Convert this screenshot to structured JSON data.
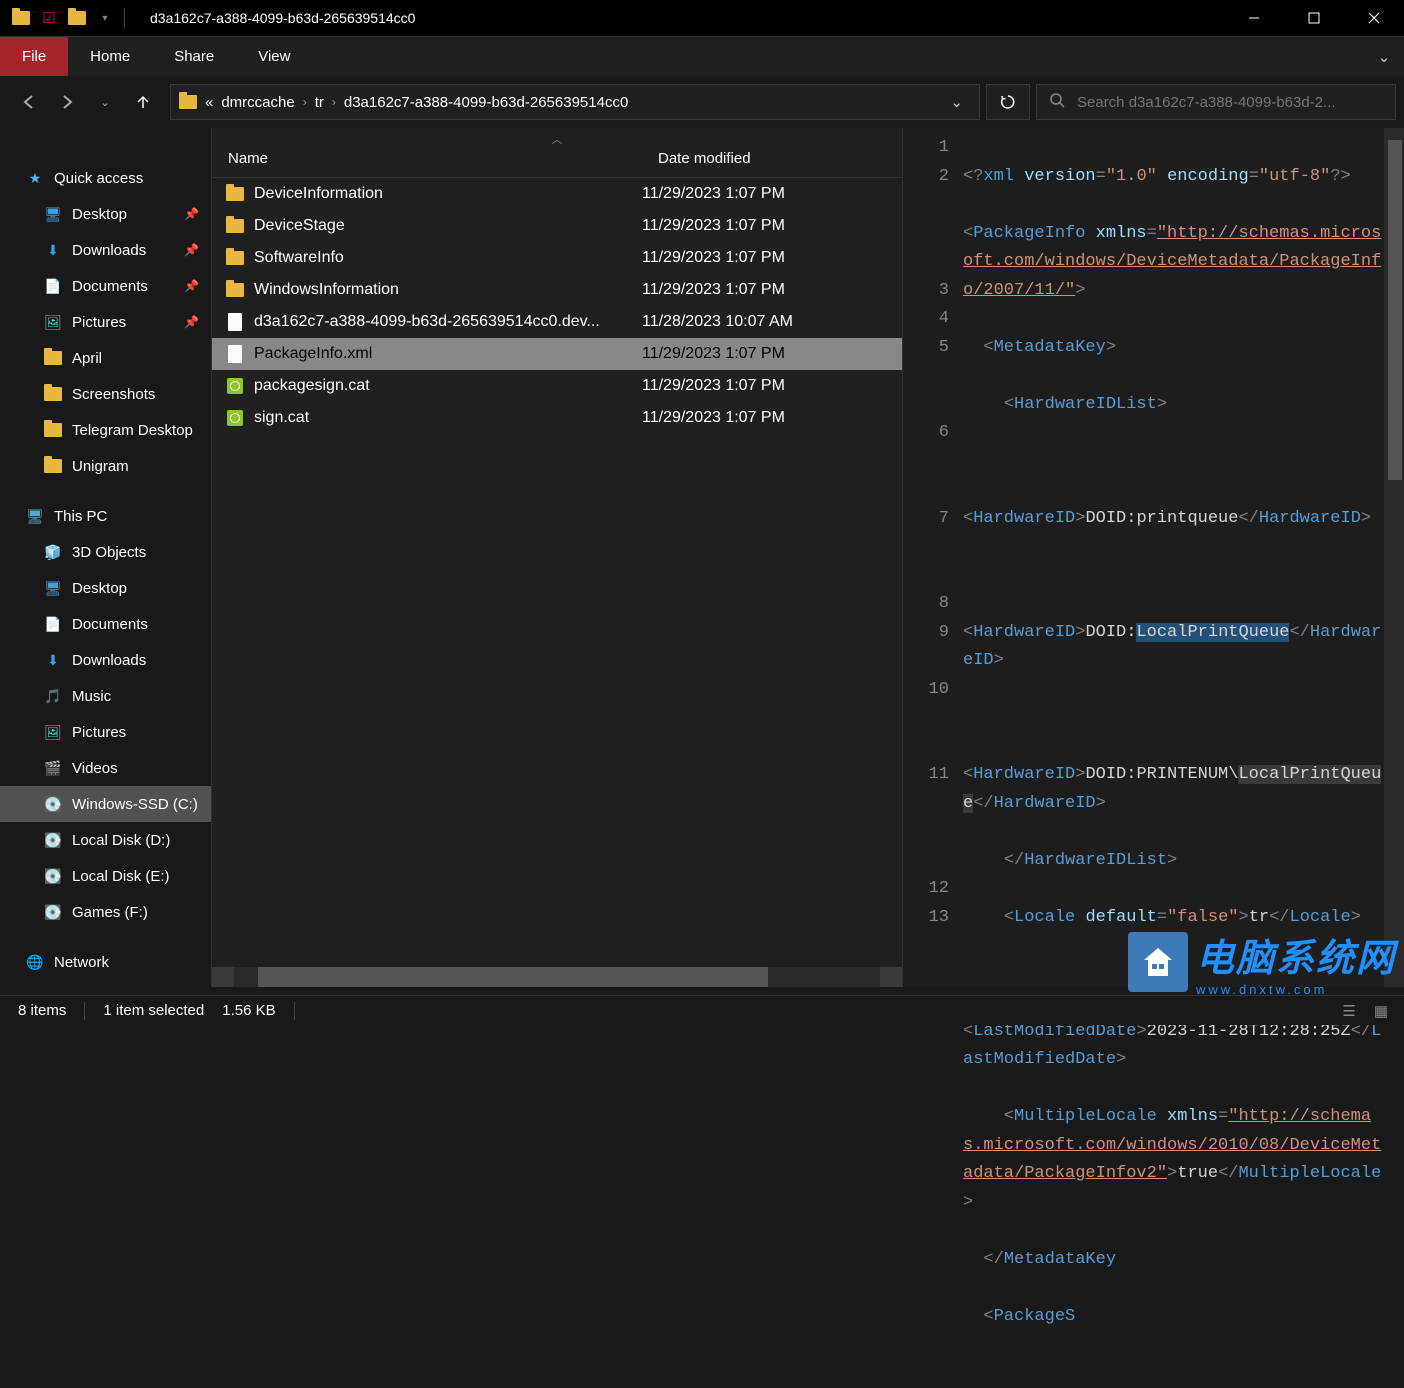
{
  "window": {
    "title": "d3a162c7-a388-4099-b63d-265639514cc0"
  },
  "ribbon": {
    "file": "File",
    "home": "Home",
    "share": "Share",
    "view": "View"
  },
  "breadcrumb": {
    "overflow": "«",
    "items": [
      "dmrccache",
      "tr",
      "d3a162c7-a388-4099-b63d-265639514cc0"
    ]
  },
  "search": {
    "placeholder": "Search d3a162c7-a388-4099-b63d-2..."
  },
  "nav": {
    "quick_access": "Quick access",
    "pinned": [
      {
        "label": "Desktop",
        "icon": "desktop"
      },
      {
        "label": "Downloads",
        "icon": "down"
      },
      {
        "label": "Documents",
        "icon": "doc"
      },
      {
        "label": "Pictures",
        "icon": "pic"
      }
    ],
    "recent": [
      {
        "label": "April"
      },
      {
        "label": "Screenshots"
      },
      {
        "label": "Telegram Desktop"
      },
      {
        "label": "Unigram"
      }
    ],
    "this_pc": "This PC",
    "pc_items": [
      {
        "label": "3D Objects"
      },
      {
        "label": "Desktop"
      },
      {
        "label": "Documents"
      },
      {
        "label": "Downloads"
      },
      {
        "label": "Music"
      },
      {
        "label": "Pictures"
      },
      {
        "label": "Videos"
      },
      {
        "label": "Windows-SSD (C:)",
        "selected": true
      },
      {
        "label": "Local Disk (D:)"
      },
      {
        "label": "Local Disk (E:)"
      },
      {
        "label": "Games (F:)"
      }
    ],
    "network": "Network"
  },
  "columns": {
    "name": "Name",
    "date": "Date modified"
  },
  "files": [
    {
      "name": "DeviceInformation",
      "type": "folder",
      "date": "11/29/2023 1:07 PM"
    },
    {
      "name": "DeviceStage",
      "type": "folder",
      "date": "11/29/2023 1:07 PM"
    },
    {
      "name": "SoftwareInfo",
      "type": "folder",
      "date": "11/29/2023 1:07 PM"
    },
    {
      "name": "WindowsInformation",
      "type": "folder",
      "date": "11/29/2023 1:07 PM"
    },
    {
      "name": "d3a162c7-a388-4099-b63d-265639514cc0.dev...",
      "type": "file",
      "date": "11/28/2023 10:07 AM"
    },
    {
      "name": "PackageInfo.xml",
      "type": "file",
      "date": "11/29/2023 1:07 PM",
      "selected": true
    },
    {
      "name": "packagesign.cat",
      "type": "cat",
      "date": "11/29/2023 1:07 PM"
    },
    {
      "name": "sign.cat",
      "type": "cat",
      "date": "11/29/2023 1:07 PM"
    }
  ],
  "preview": {
    "lines": [
      "1",
      "2",
      "",
      "",
      "",
      "3",
      "4",
      "5",
      "",
      "",
      "6",
      "",
      "",
      "7",
      "",
      "",
      "8",
      "9",
      "",
      "10",
      "",
      "",
      "11",
      "",
      "",
      "",
      "12",
      "13"
    ],
    "xml_decl": {
      "open": "<?",
      "name": "xml",
      "attr1": "version",
      "val1": "\"1.0\"",
      "attr2": "encoding",
      "val2": "\"utf-8\"",
      "close": "?>"
    },
    "pkg": {
      "open": "<",
      "name": "PackageInfo",
      "attr": "xmlns",
      "eq": "=",
      "url": "\"http://schemas.microsoft.com/windows/DeviceMetadata/PackageInfo/2007/11/\"",
      "close": ">"
    },
    "mk": {
      "open": "<",
      "name": "MetadataKey",
      "close": ">"
    },
    "hwlist": {
      "open": "<",
      "name": "HardwareIDList",
      "close": ">"
    },
    "hw1": {
      "open": "<",
      "name": "HardwareID",
      "close": ">",
      "text": "DOID:printqueue",
      "copen": "</",
      "cclose": ">"
    },
    "hw2": {
      "open": "<",
      "name": "HardwareID",
      "close": ">",
      "prefix": "DOID:",
      "hl": "LocalPrintQueue",
      "copen": "</",
      "cclose": ">"
    },
    "hw3": {
      "open": "<",
      "name": "HardwareID",
      "close": ">",
      "prefix": "DOID:PRINTENUM\\",
      "hl": "LocalPrintQueue",
      "copen": "</",
      "cclose": ">"
    },
    "hwlistc": {
      "open": "</",
      "name": "HardwareIDList",
      "close": ">"
    },
    "locale": {
      "open": "<",
      "name": "Locale",
      "attr": "default",
      "val": "\"false\"",
      "close": ">",
      "text": "tr",
      "copen": "</",
      "cclose": ">"
    },
    "lmd": {
      "open": "<",
      "name": "LastModifiedDate",
      "close": ">",
      "text": "2023-11-28T12:28:25Z",
      "copen": "</",
      "cclose": ">"
    },
    "ml": {
      "open": "<",
      "name": "MultipleLocale",
      "attr": "xmlns",
      "url": "\"http://schemas.microsoft.com/windows/2010/08/DeviceMetadata/PackageInfov2\"",
      "close": ">",
      "text": "true",
      "copen": "</",
      "cclose": ">"
    },
    "mkc": {
      "open": "</",
      "name": "MetadataKey",
      "closepartial": ""
    },
    "ps": {
      "open": "<",
      "name": "PackageS"
    }
  },
  "status": {
    "count": "8 items",
    "selection": "1 item selected",
    "size": "1.56 KB"
  },
  "watermark": {
    "big": "电脑系统网",
    "small": "www.dnxtw.com"
  }
}
